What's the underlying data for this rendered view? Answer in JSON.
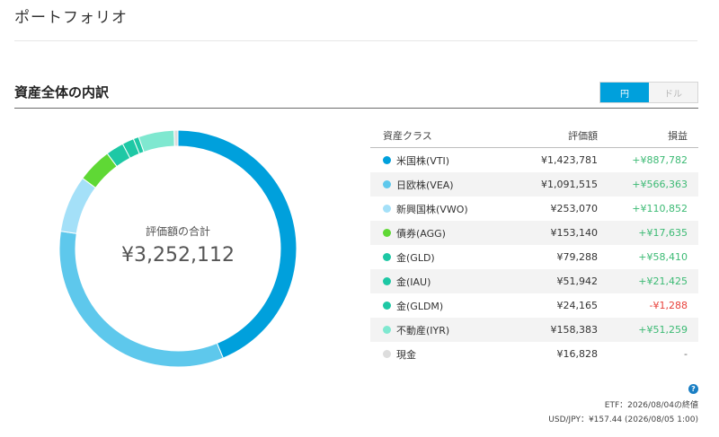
{
  "page": {
    "title": "ポートフォリオ"
  },
  "section": {
    "title": "資産全体の内訳",
    "currency_toggle": {
      "yen": "円",
      "dollar": "ドル",
      "selected": "円"
    }
  },
  "donut": {
    "label": "評価額の合計",
    "total": "¥3,252,112"
  },
  "table": {
    "headers": {
      "asset_class": "資産クラス",
      "value": "評価額",
      "pl": "損益"
    },
    "rows": [
      {
        "name": "米国株(VTI)",
        "value": "¥1,423,781",
        "pl": "+¥887,782",
        "pl_sign": "pos",
        "color": "#00a0dc",
        "amount": 1423781
      },
      {
        "name": "日欧株(VEA)",
        "value": "¥1,091,515",
        "pl": "+¥566,363",
        "pl_sign": "pos",
        "color": "#5ec8ec",
        "amount": 1091515
      },
      {
        "name": "新興国株(VWO)",
        "value": "¥253,070",
        "pl": "+¥110,852",
        "pl_sign": "pos",
        "color": "#a4e0f8",
        "amount": 253070
      },
      {
        "name": "債券(AGG)",
        "value": "¥153,140",
        "pl": "+¥17,635",
        "pl_sign": "pos",
        "color": "#5fd835",
        "amount": 153140
      },
      {
        "name": "金(GLD)",
        "value": "¥79,288",
        "pl": "+¥58,410",
        "pl_sign": "pos",
        "color": "#1ec8a5",
        "amount": 79288
      },
      {
        "name": "金(IAU)",
        "value": "¥51,942",
        "pl": "+¥21,425",
        "pl_sign": "pos",
        "color": "#1ec8a5",
        "amount": 51942
      },
      {
        "name": "金(GLDM)",
        "value": "¥24,165",
        "pl": "-¥1,288",
        "pl_sign": "neg",
        "color": "#1ec8a5",
        "amount": 24165
      },
      {
        "name": "不動産(IYR)",
        "value": "¥158,383",
        "pl": "+¥51,259",
        "pl_sign": "pos",
        "color": "#7fe8d0",
        "amount": 158383
      },
      {
        "name": "現金",
        "value": "¥16,828",
        "pl": "-",
        "pl_sign": "nil",
        "color": "#dddddd",
        "amount": 16828
      }
    ]
  },
  "footnotes": {
    "etf": "ETF：2026/08/04の終値",
    "fx": "USD/JPY：¥157.44 (2026/08/05 1:00)"
  }
}
